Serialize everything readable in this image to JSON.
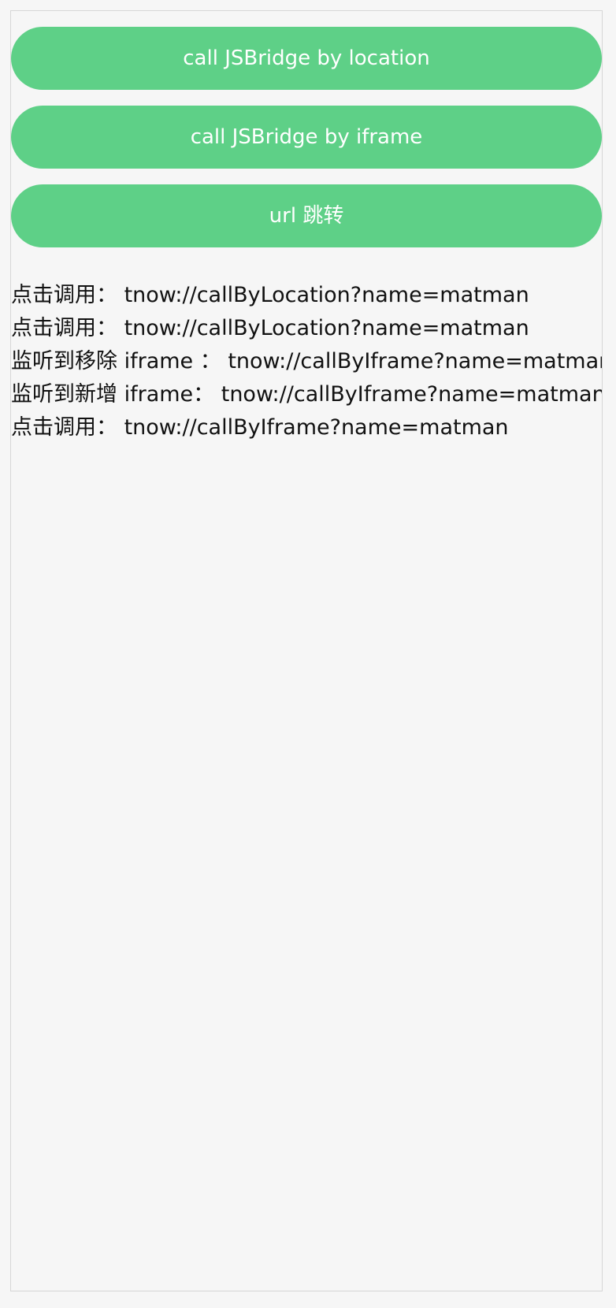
{
  "buttons": [
    {
      "label": "call JSBridge by location"
    },
    {
      "label": "call JSBridge by iframe"
    },
    {
      "label": "url 跳转"
    }
  ],
  "log": [
    "点击调用： tnow://callByLocation?name=matman",
    "点击调用： tnow://callByLocation?name=matman",
    "监听到移除 iframe ： tnow://callByIframe?name=matman",
    "监听到新增 iframe： tnow://callByIframe?name=matman",
    "点击调用： tnow://callByIframe?name=matman"
  ],
  "colors": {
    "button_bg": "#5ed087",
    "button_text": "#ffffff",
    "page_bg": "#f6f6f6",
    "text": "#111111"
  }
}
